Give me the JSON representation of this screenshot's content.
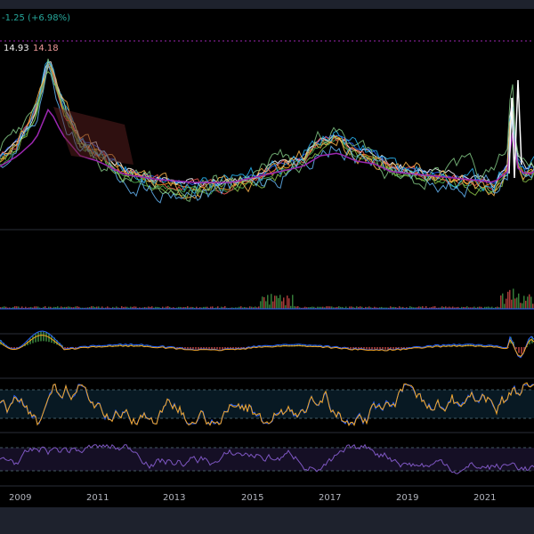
{
  "header": {
    "change_text": "-1.25 (+6.98%)",
    "value_a": "14.93",
    "value_b": "14.18"
  },
  "x_axis": {
    "years": [
      "2009",
      "2011",
      "2013",
      "2015",
      "2017",
      "2019",
      "2021"
    ]
  },
  "colors": {
    "background": "#000000",
    "panel_sep": "#2a2e39",
    "change_green": "#26a69a",
    "value_a": "#f0f0f0",
    "value_b": "#ef9a9a",
    "purple": "#9c27b0",
    "blue": "#2962ff",
    "orange": "#f5a623",
    "green": "#4caf50",
    "white": "#ffffff",
    "red": "#ef5350",
    "violet": "#7e57c2"
  },
  "panels": {
    "main": "price with moving averages",
    "volume": "volume histogram",
    "macd": "MACD",
    "stochastic": "stochastic oscillator",
    "rsi": "RSI"
  }
}
